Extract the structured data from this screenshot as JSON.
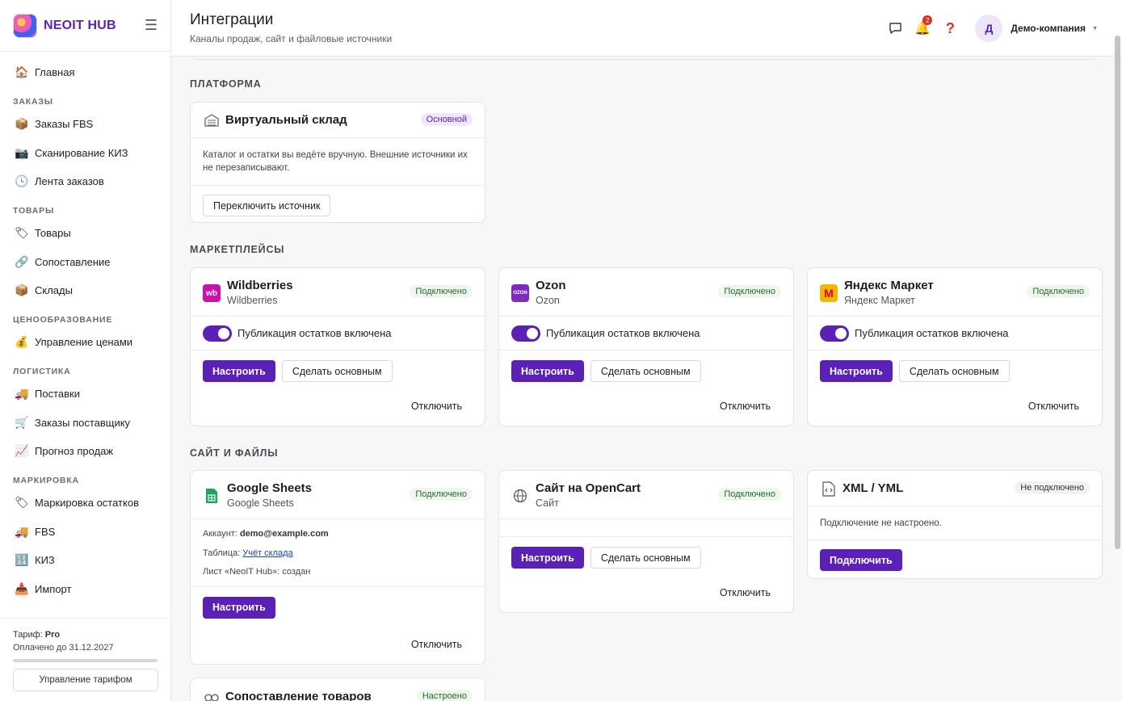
{
  "brand": {
    "name": "NEOIT HUB"
  },
  "sidebar": {
    "home": {
      "label": "Главная",
      "icon": "house-icon"
    },
    "sections": [
      {
        "title": "ЗАКАЗЫ",
        "items": [
          {
            "label": "Заказы FBS",
            "icon": "package-icon"
          },
          {
            "label": "Сканирование КИЗ",
            "icon": "camera-icon"
          },
          {
            "label": "Лента заказов",
            "icon": "clock-icon"
          }
        ]
      },
      {
        "title": "ТОВАРЫ",
        "items": [
          {
            "label": "Товары",
            "icon": "tag-icon"
          },
          {
            "label": "Сопоставление",
            "icon": "link-icon"
          },
          {
            "label": "Склады",
            "icon": "package-icon"
          }
        ]
      },
      {
        "title": "ЦЕНООБРАЗОВАНИЕ",
        "items": [
          {
            "label": "Управление ценами",
            "icon": "money-bag-icon"
          }
        ]
      },
      {
        "title": "ЛОГИСТИКА",
        "items": [
          {
            "label": "Поставки",
            "icon": "truck-icon"
          },
          {
            "label": "Заказы поставщику",
            "icon": "cart-icon"
          },
          {
            "label": "Прогноз продаж",
            "icon": "chart-up-icon"
          }
        ]
      },
      {
        "title": "МАРКИРОВКА",
        "items": [
          {
            "label": "Маркировка остатков",
            "icon": "tag-icon"
          },
          {
            "label": "FBS",
            "icon": "truck-icon"
          },
          {
            "label": "КИЗ",
            "icon": "numbers-icon"
          },
          {
            "label": "Импорт",
            "icon": "inbox-icon"
          }
        ]
      }
    ],
    "footer": {
      "plan_label": "Тариф:",
      "plan_value": "Pro",
      "paid_until": "Оплачено до 31.12.2027",
      "manage_button": "Управление тарифом"
    }
  },
  "header": {
    "title": "Интеграции",
    "subtitle": "Каналы продаж, сайт и файловые источники",
    "notifications_count": "2",
    "avatar_letter": "Д",
    "company": "Демо-компания"
  },
  "sections": {
    "platform": "ПЛАТФОРМА",
    "marketplaces": "МАРКЕТПЛЕЙСЫ",
    "site_files": "САЙТ И ФАЙЛЫ"
  },
  "platform_card": {
    "name": "Виртуальный склад",
    "status": "Основной",
    "description": "Каталог и остатки вы ведёте вручную. Внешние источники их не перезаписывают.",
    "button": "Переключить источник"
  },
  "marketplaces": [
    {
      "name": "Wildberries",
      "sub": "Wildberries",
      "status": "Подключено",
      "icon_text": "wb",
      "color": "#cb11ab"
    },
    {
      "name": "Ozon",
      "sub": "Ozon",
      "status": "Подключено",
      "icon_text": "OZON",
      "color": "#7b2cbf"
    },
    {
      "name": "Яндекс Маркет",
      "sub": "Яндекс Маркет",
      "status": "Подключено",
      "icon_text": "M",
      "color": "#f7b500"
    }
  ],
  "common": {
    "toggle_label": "Публикация остатков включена",
    "configure": "Настроить",
    "make_main": "Сделать основным",
    "disconnect": "Отключить",
    "connect": "Подключить"
  },
  "google_sheets": {
    "name": "Google Sheets",
    "sub": "Google Sheets",
    "status": "Подключено",
    "account_label": "Аккаунт:",
    "account_value": "demo@example.com",
    "table_label": "Таблица:",
    "table_value": "Учёт склада",
    "sheet_line": "Лист «NeoIT Hub»: создан"
  },
  "opencart": {
    "name": "Сайт на OpenCart",
    "sub": "Сайт",
    "status": "Подключено"
  },
  "xml": {
    "name": "XML / YML",
    "status": "Не подключено",
    "description": "Подключение не настроено."
  },
  "matching": {
    "name": "Сопоставление товаров",
    "status": "Настроено"
  }
}
